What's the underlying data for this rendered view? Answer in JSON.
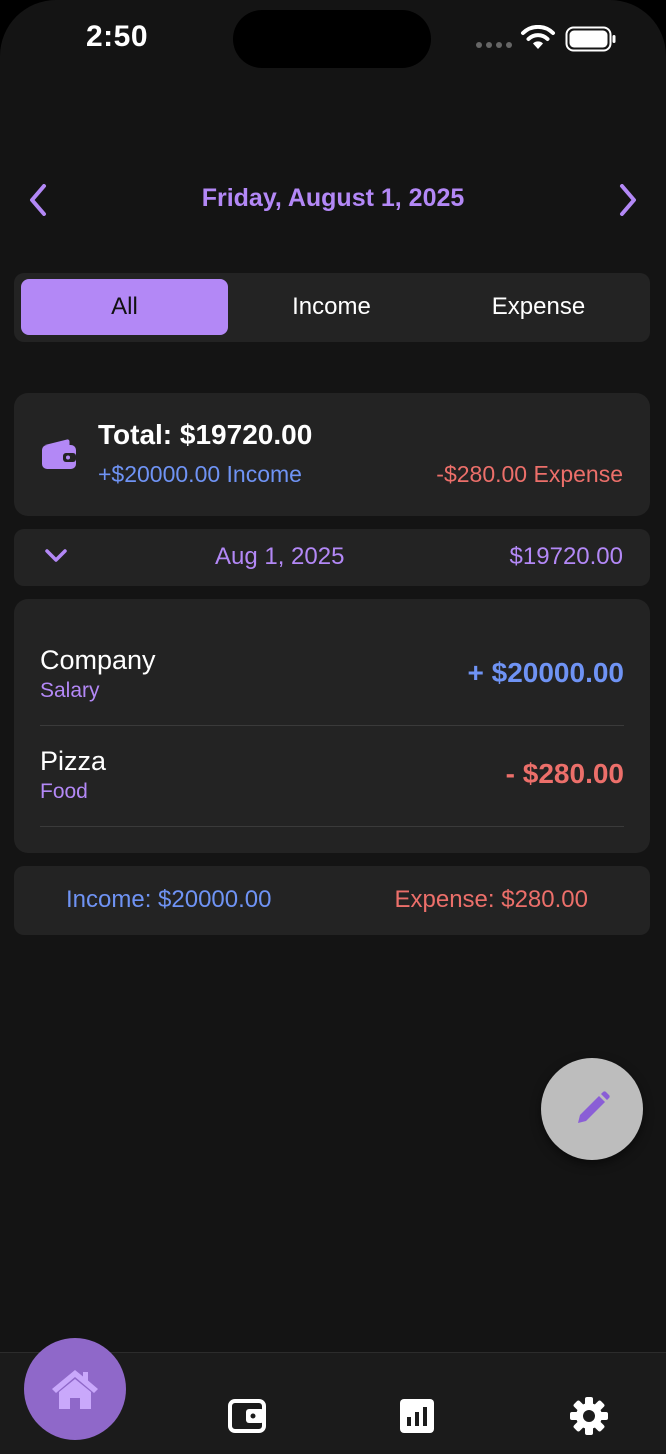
{
  "status_bar": {
    "time": "2:50"
  },
  "header": {
    "date": "Friday, August 1, 2025",
    "prev_icon": "chevron-left-icon",
    "next_icon": "chevron-right-icon"
  },
  "filter": {
    "options": [
      "All",
      "Income",
      "Expense"
    ],
    "selected": "All"
  },
  "summary": {
    "total": "Total: $19720.00",
    "income": "+$20000.00 Income",
    "expense": "-$280.00 Expense",
    "icon": "wallet-icon"
  },
  "group": {
    "date": "Aug 1, 2025",
    "total": "$19720.00",
    "icon": "chevron-down-icon"
  },
  "transactions": [
    {
      "name": "Company",
      "category": "Salary",
      "amount": "+ $20000.00",
      "type": "income"
    },
    {
      "name": "Pizza",
      "category": "Food",
      "amount": "- $280.00",
      "type": "expense"
    }
  ],
  "footer": {
    "income": "Income: $20000.00",
    "expense": "Expense: $280.00"
  },
  "fab": {
    "icon": "pencil-icon"
  },
  "tab_bar": {
    "items": [
      {
        "icon": "home-icon",
        "active": true
      },
      {
        "icon": "wallet-icon",
        "active": false
      },
      {
        "icon": "chart-icon",
        "active": false
      },
      {
        "icon": "gear-icon",
        "active": false
      }
    ]
  },
  "colors": {
    "accent": "#b388f6",
    "income": "#6f93f4",
    "expense": "#ec6f6a",
    "background": "#141414",
    "card": "#232323"
  }
}
